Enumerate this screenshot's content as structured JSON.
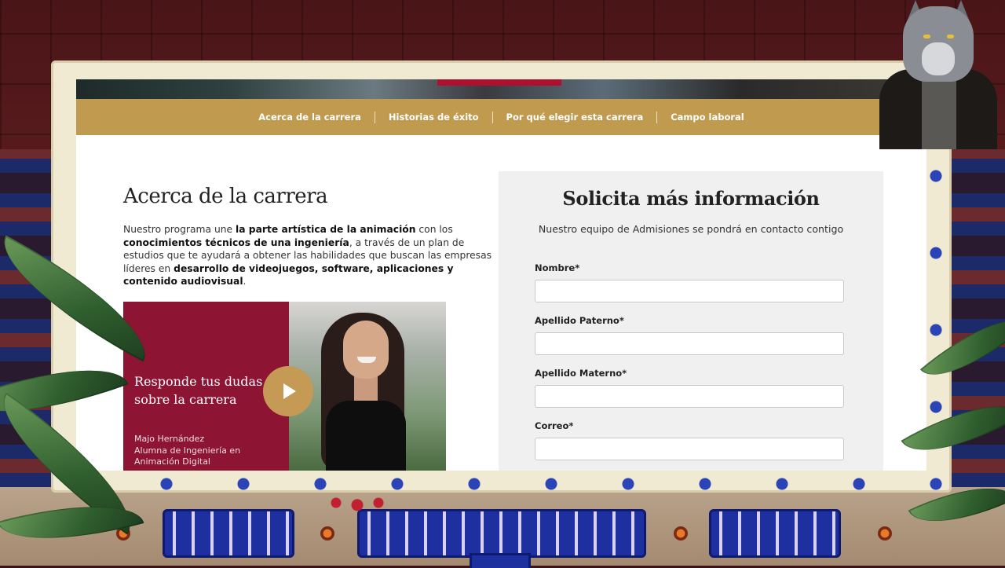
{
  "nav": {
    "items": [
      {
        "label": "Acerca de la carrera"
      },
      {
        "label": "Historias de éxito"
      },
      {
        "label": "Por qué elegir esta carrera"
      },
      {
        "label": "Campo laboral"
      }
    ]
  },
  "about": {
    "title": "Acerca de la carrera",
    "p1": "Nuestro programa une ",
    "b1": "la parte artística de la animación",
    "p2": " con los ",
    "b2": "conocimientos técnicos de una ingeniería",
    "p3": ", a través de un plan de estudios que te ayudará a obtener las habilidades que buscan las empresas líderes en ",
    "b3": "desarrollo de videojuegos, software, aplicaciones y contenido audiovisual",
    "p4": "."
  },
  "video": {
    "heading": "Responde tus dudas sobre la carrera",
    "person_name": "Majo Hernández",
    "person_role": "Alumna de Ingeniería en Animación Digital",
    "play_icon": "play-icon"
  },
  "form": {
    "title": "Solicita más información",
    "subtitle": "Nuestro equipo de Admisiones se pondrá en contacto contigo",
    "fields": [
      {
        "label": "Nombre*",
        "value": ""
      },
      {
        "label": "Apellido Paterno*",
        "value": ""
      },
      {
        "label": "Apellido Materno*",
        "value": ""
      },
      {
        "label": "Correo*",
        "value": ""
      }
    ]
  },
  "colors": {
    "nav_gold": "#c09a4e",
    "video_burgundy": "#8e1434",
    "play_gold": "#c49a54",
    "form_bg": "#f0f0f0"
  }
}
